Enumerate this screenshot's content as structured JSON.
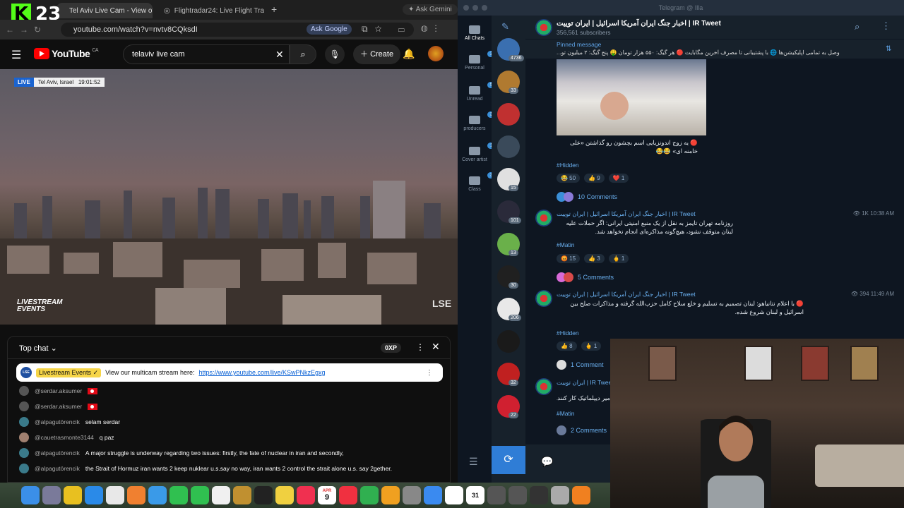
{
  "kick": {
    "count": "23"
  },
  "browser": {
    "tab1_title": "Tel Aviv Live Cam - View of Tel Aviv",
    "tab2_title": "Flightradar24: Live Flight Tracker",
    "ask_gemini": "Ask Gemini",
    "url": "youtube.com/watch?v=nvtv8CQksdI",
    "ask_google": "Ask Google"
  },
  "youtube": {
    "logo": "YouTube",
    "region": "CA",
    "search_value": "telaviv live cam",
    "create_label": "Create",
    "live_badge": "LIVE",
    "location": "Tel Aviv, Israel",
    "time": "19:01:52",
    "watermark_brand": "LIVESTREAM EVENTS",
    "watermark_mark": "LSE"
  },
  "livechat": {
    "title": "Top chat",
    "xp": "0XP",
    "pinned": {
      "avatar": "LSE",
      "author": "Livestream Events ✓",
      "text": "View our multicam stream here:",
      "link": "https://www.youtube.com/live/KSwPNkzEgxg"
    },
    "messages": [
      {
        "author": "@serdar.aksumer",
        "text": "",
        "flag": true
      },
      {
        "author": "@serdar.aksumer",
        "text": "",
        "flag": true
      },
      {
        "author": "@alpagutörencik",
        "text": "selam serdar",
        "flag": false
      },
      {
        "author": "@cauetrasmonte3144",
        "text": "q paz",
        "flag": false
      },
      {
        "author": "@alpagutörencik",
        "text": "A major struggle is underway regarding two issues: firstly, the fate of nuclear in iran and secondly,",
        "flag": false
      },
      {
        "author": "@alpagutörencik",
        "text": "the Strait of Hormuz iran wants 2 keep nuklear u.s.say no way, iran wants 2 control the strait alone u.s. say 2gether.",
        "flag": false
      }
    ]
  },
  "telegram": {
    "window_title": "Telegram @ Illa",
    "folders": [
      {
        "label": "All Chats",
        "badge": ""
      },
      {
        "label": "Personal",
        "badge": "393"
      },
      {
        "label": "Unread",
        "badge": "538"
      },
      {
        "label": "producers",
        "badge": "3"
      },
      {
        "label": "Cover artist",
        "badge": "1"
      },
      {
        "label": "Class",
        "badge": "3"
      }
    ],
    "chat_badges": [
      "4736",
      "33",
      "",
      "",
      "15",
      "101",
      "13",
      "30",
      "206",
      "",
      "32",
      "22"
    ],
    "channel": {
      "title": "اخبار جنگ ایران آمریکا اسرائیل | ایران توییت | IR Tweet",
      "subscribers": "356,561 subscribers"
    },
    "pinned": {
      "label": "Pinned message",
      "snippet": "وصل به تمامی اپلیکیشن‌ها 🌐 با پشتیبانی تا مصرف آخرین مگابایت 🔴 هر گیگ: ۵۵۰ هزار تومان 🤑 پنج گیگ: ۲ میلیون تو..."
    },
    "posts": [
      {
        "caption": "🔴 یه زوج اندونزیایی اسم بچشون رو گذاشتن «علی خامنه ای» 😂😂",
        "tag": "#Hidden",
        "reactions": [
          "😂 50",
          "👍 9",
          "❤️ 1"
        ],
        "comments": "10 Comments"
      },
      {
        "name": "اخبار جنگ ایران آمریکا اسرائیل | ایران توییت | IR Tweet",
        "views": "1K 10:38 AM",
        "text": "روزنامه تهران تایمز به نقل از یک منبع امنیتی ایرانی: اگر حملات علیه لبنان متوقف نشود، هیچ‌گونه مذاکره‌ای انجام نخواهد شد.",
        "tag": "#Matin",
        "reactions": [
          "😡 15",
          "👍 3",
          "🖕 1"
        ],
        "comments": "5 Comments"
      },
      {
        "name": "اخبار جنگ ایران آمریکا اسرائیل | ایران توییت | IR Tweet",
        "views": "394 11:49 AM",
        "text": "🔴 با اعلام نتانیاهو: لبنان تصمیم به تسلیم و خلع سلاح کامل حزب‌الله گرفته و مذاکرات صلح بین اسرائیل و لبنان شروع شده.",
        "tag": "#Hidden",
        "reactions": [
          "👍 8",
          "🖕 1"
        ],
        "comments": "1 Comment"
      },
      {
        "name": "ایران توییت | IR Tweet",
        "text": "میر دیپلماتیک کار کنند.",
        "tag": "#Matin",
        "comments": "2 Comments"
      }
    ]
  },
  "dock": {
    "calendar_month": "APR",
    "calendar_day": "9",
    "date_icon": "31"
  }
}
